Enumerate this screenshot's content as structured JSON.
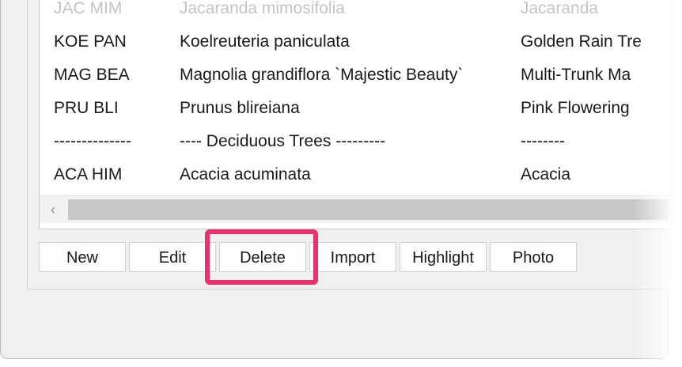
{
  "list": {
    "rows": [
      {
        "code": "JAC MIM",
        "name": "Jacaranda mimosifolia",
        "common": "Jacaranda"
      },
      {
        "code": "KOE PAN",
        "name": "Koelreuteria paniculata",
        "common": "Golden Rain Tre"
      },
      {
        "code": "MAG BEA",
        "name": "Magnolia grandiflora `Majestic Beauty`",
        "common": "Multi-Trunk Ma"
      },
      {
        "code": "PRU BLI",
        "name": "Prunus blireiana",
        "common": "Pink Flowering"
      },
      {
        "code": "--------------",
        "name": "---- Deciduous Trees ---------",
        "common": "--------"
      },
      {
        "code": "ACA HIM",
        "name": "Acacia acuminata",
        "common": "Acacia"
      }
    ]
  },
  "scrollbar": {
    "left_arrow": "‹"
  },
  "buttons": {
    "new": "New",
    "edit": "Edit",
    "delete": "Delete",
    "import": "Import",
    "highlight": "Highlight",
    "photo": "Photo"
  },
  "colors": {
    "highlight_border": "#e8326f"
  }
}
